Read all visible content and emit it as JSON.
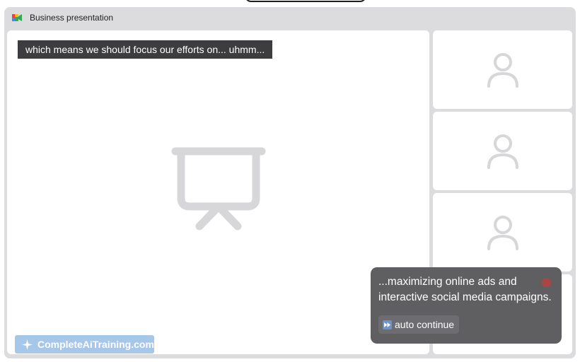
{
  "window": {
    "title": "Business presentation",
    "app_icon": "video-meeting-app-icon"
  },
  "main_stage": {
    "caption": "which means we should focus our efforts on... uhmm...",
    "center_icon": "presentation-board-icon",
    "brand": "CompleteAiTraining.com",
    "brand_icon": "sparkle-icon",
    "colors": {
      "caption_bg": "#3d3d3f",
      "brand_bg": "#a6c6ea"
    }
  },
  "participants": {
    "tiles": [
      {
        "icon": "person-icon"
      },
      {
        "icon": "person-icon"
      },
      {
        "icon": "person-icon"
      },
      {
        "icon": "person-icon"
      }
    ]
  },
  "popup": {
    "text": "...maximizing online ads and interactive social media campaigns.",
    "auto_continue_label": "auto continue",
    "auto_continue_icon": "fast-forward-icon",
    "recording_indicator_color": "#a84646"
  }
}
